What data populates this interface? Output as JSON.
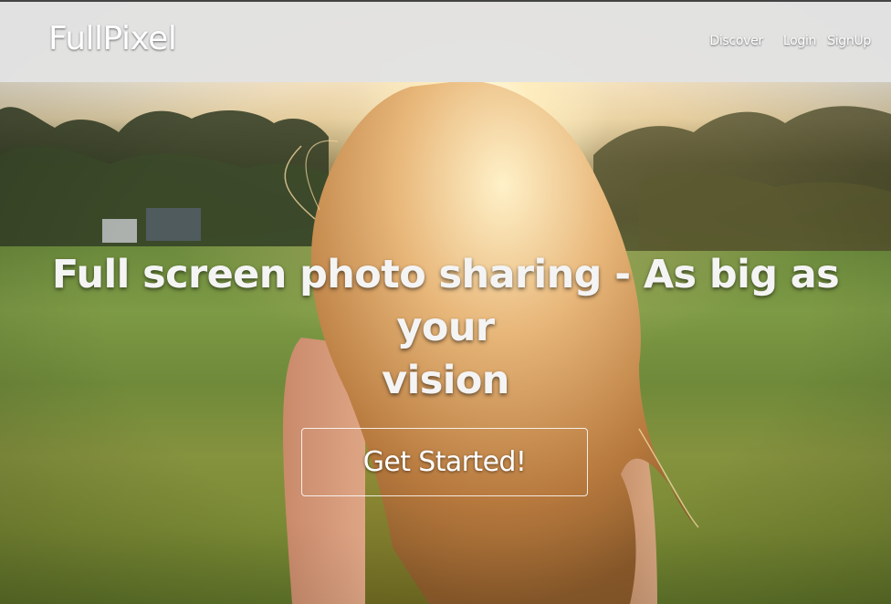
{
  "brand": {
    "name": "FullPixel"
  },
  "nav": {
    "items": [
      {
        "label": "Discover"
      },
      {
        "label": "Login"
      },
      {
        "label": "SignUp"
      }
    ]
  },
  "hero": {
    "headline_line1": "Full screen photo sharing - As big as your",
    "headline_line2": "vision",
    "cta_label": "Get Started!"
  },
  "colors": {
    "navbar_bg": "#e2e2e2",
    "text": "#ffffff",
    "button_border": "#ffffff"
  }
}
